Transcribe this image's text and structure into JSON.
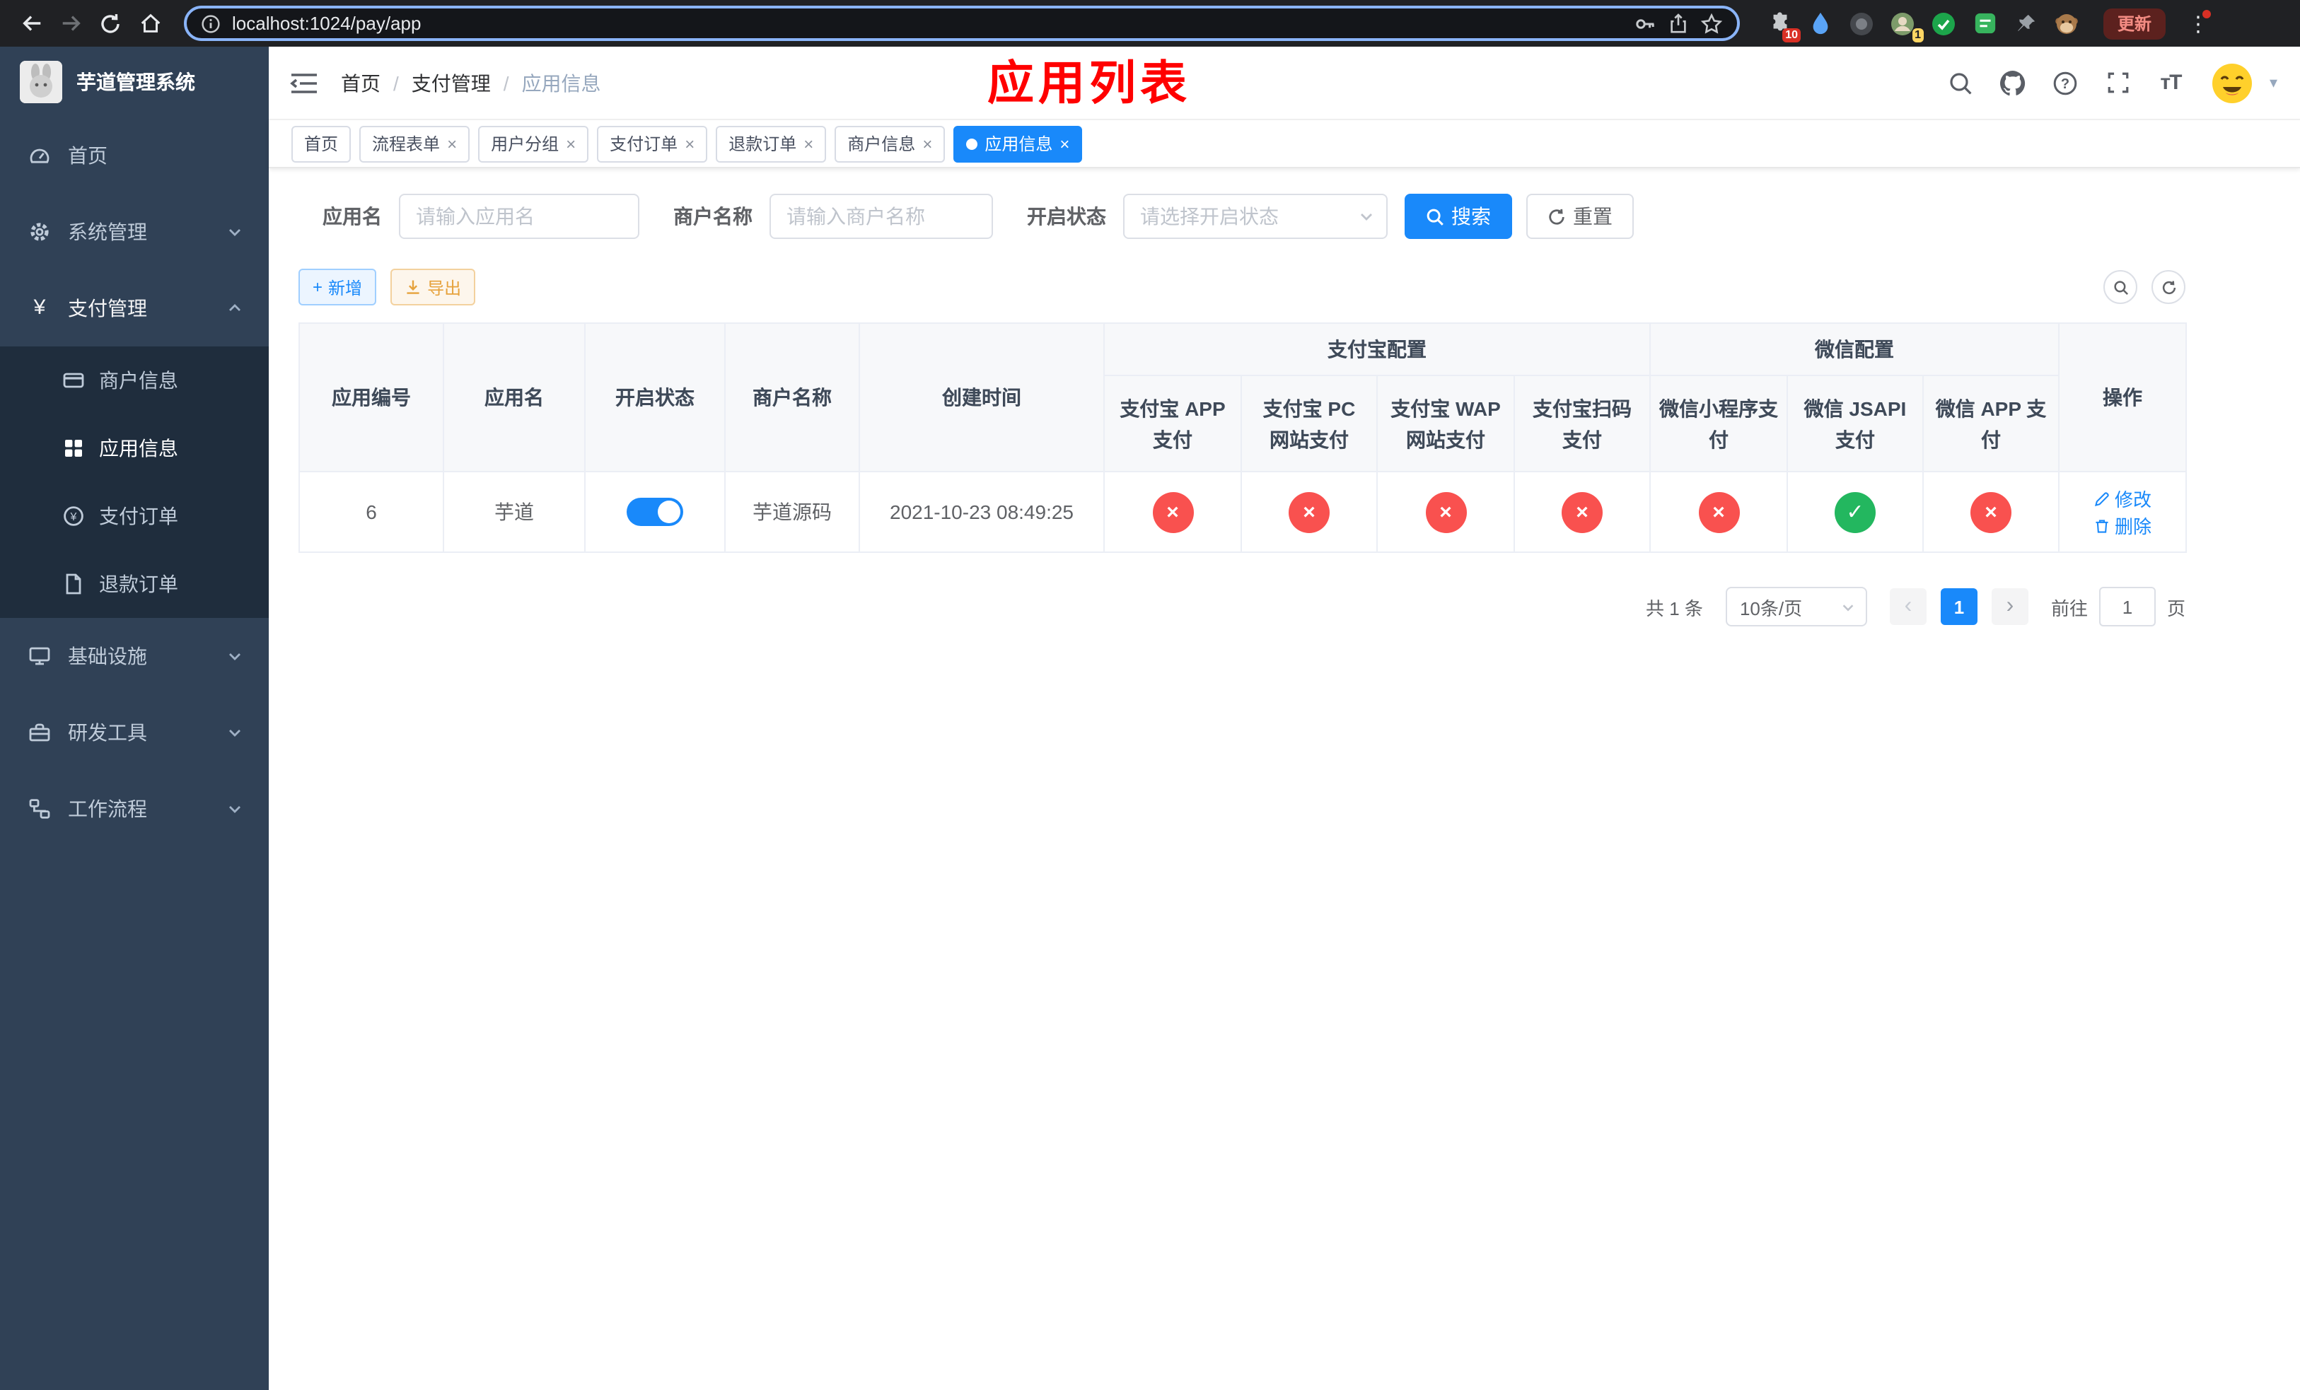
{
  "browser": {
    "url": "localhost:1024/pay/app",
    "update_button": "更新",
    "extension_badge_count": "10",
    "profile_badge_count": "1"
  },
  "icons": {
    "close": "×",
    "check": "✓",
    "cross": "×",
    "plus": "+",
    "menu_dots": "⋮",
    "caret_down": "▾",
    "yuan": "¥",
    "question": "?",
    "info": "i",
    "prev_arrow": "‹",
    "next_arrow": "›"
  },
  "sidebar": {
    "title": "芋道管理系统",
    "home": "首页",
    "system": "系统管理",
    "payment": "支付管理",
    "merchant_info": "商户信息",
    "app_info": "应用信息",
    "pay_order": "支付订单",
    "refund_order": "退款订单",
    "infra": "基础设施",
    "devtools": "研发工具",
    "workflow": "工作流程"
  },
  "header": {
    "breadcrumb": [
      "首页",
      "支付管理",
      "应用信息"
    ],
    "overlay_title": "应用列表"
  },
  "tabs": [
    {
      "label": "首页"
    },
    {
      "label": "流程表单"
    },
    {
      "label": "用户分组"
    },
    {
      "label": "支付订单"
    },
    {
      "label": "退款订单"
    },
    {
      "label": "商户信息"
    },
    {
      "label": "应用信息"
    }
  ],
  "filters": {
    "app_name_label": "应用名",
    "app_name_placeholder": "请输入应用名",
    "merchant_label": "商户名称",
    "merchant_placeholder": "请输入商户名称",
    "status_label": "开启状态",
    "status_placeholder": "请选择开启状态",
    "search_button": "搜索",
    "reset_button": "重置"
  },
  "toolbar": {
    "add_button": "新增",
    "export_button": "导出"
  },
  "table": {
    "headers": {
      "app_id": "应用编号",
      "app_name": "应用名",
      "status": "开启状态",
      "merchant_name": "商户名称",
      "create_time": "创建时间",
      "alipay_group": "支付宝配置",
      "wechat_group": "微信配置",
      "alipay_app": "支付宝 APP 支付",
      "alipay_pc": "支付宝 PC 网站支付",
      "alipay_wap": "支付宝 WAP 网站支付",
      "alipay_qr": "支付宝扫码支付",
      "wx_mini": "微信小程序支付",
      "wx_jsapi": "微信 JSAPI 支付",
      "wx_app": "微信 APP 支付",
      "actions": "操作"
    },
    "rows": [
      {
        "app_id": "6",
        "app_name": "芋道",
        "enabled": true,
        "merchant_name": "芋道源码",
        "create_time": "2021-10-23 08:49:25",
        "configs": {
          "alipay_app": false,
          "alipay_pc": false,
          "alipay_wap": false,
          "alipay_qr": false,
          "wx_mini": false,
          "wx_jsapi": true,
          "wx_app": false
        },
        "edit": "修改",
        "delete": "删除"
      }
    ]
  },
  "pagination": {
    "total": "共 1 条",
    "page_size": "10条/页",
    "current_page": "1",
    "goto_label": "前往",
    "goto_value": "1",
    "goto_unit": "页"
  },
  "colors": {
    "primary": "#1989fa",
    "success": "#23b75f",
    "danger": "#f9514f",
    "warning": "#e6a23c",
    "title_red": "#ff0000"
  }
}
